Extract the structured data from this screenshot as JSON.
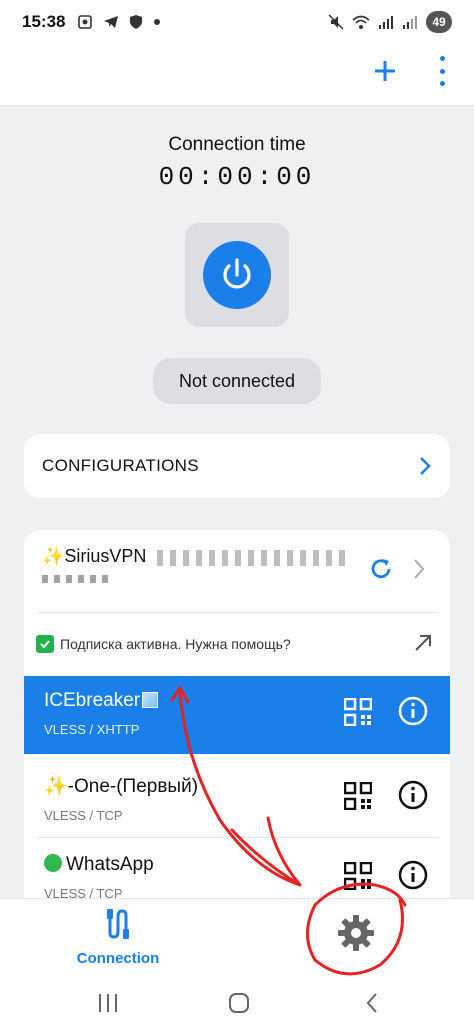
{
  "status_bar": {
    "time": "15:38",
    "battery": "49"
  },
  "connection": {
    "label": "Connection time",
    "time": "00:00:00",
    "status": "Not connected"
  },
  "configurations": {
    "label": "CONFIGURATIONS"
  },
  "subscription": {
    "name": "✨SiriusVPN",
    "notice": "Подписка активна. Нужна помощь?"
  },
  "servers": [
    {
      "name": "ICEbreaker",
      "protocol": "VLESS / XHTTP",
      "active": true
    },
    {
      "name": "✨-One-(Первый)",
      "protocol": "VLESS / TCP",
      "active": false
    },
    {
      "name": "WhatsApp",
      "protocol": "VLESS / TCP",
      "active": false
    }
  ],
  "bottom_nav": {
    "connection_label": "Connection"
  },
  "colors": {
    "accent": "#1a7fe8",
    "annotation": "#e52323",
    "success": "#23b14d"
  }
}
